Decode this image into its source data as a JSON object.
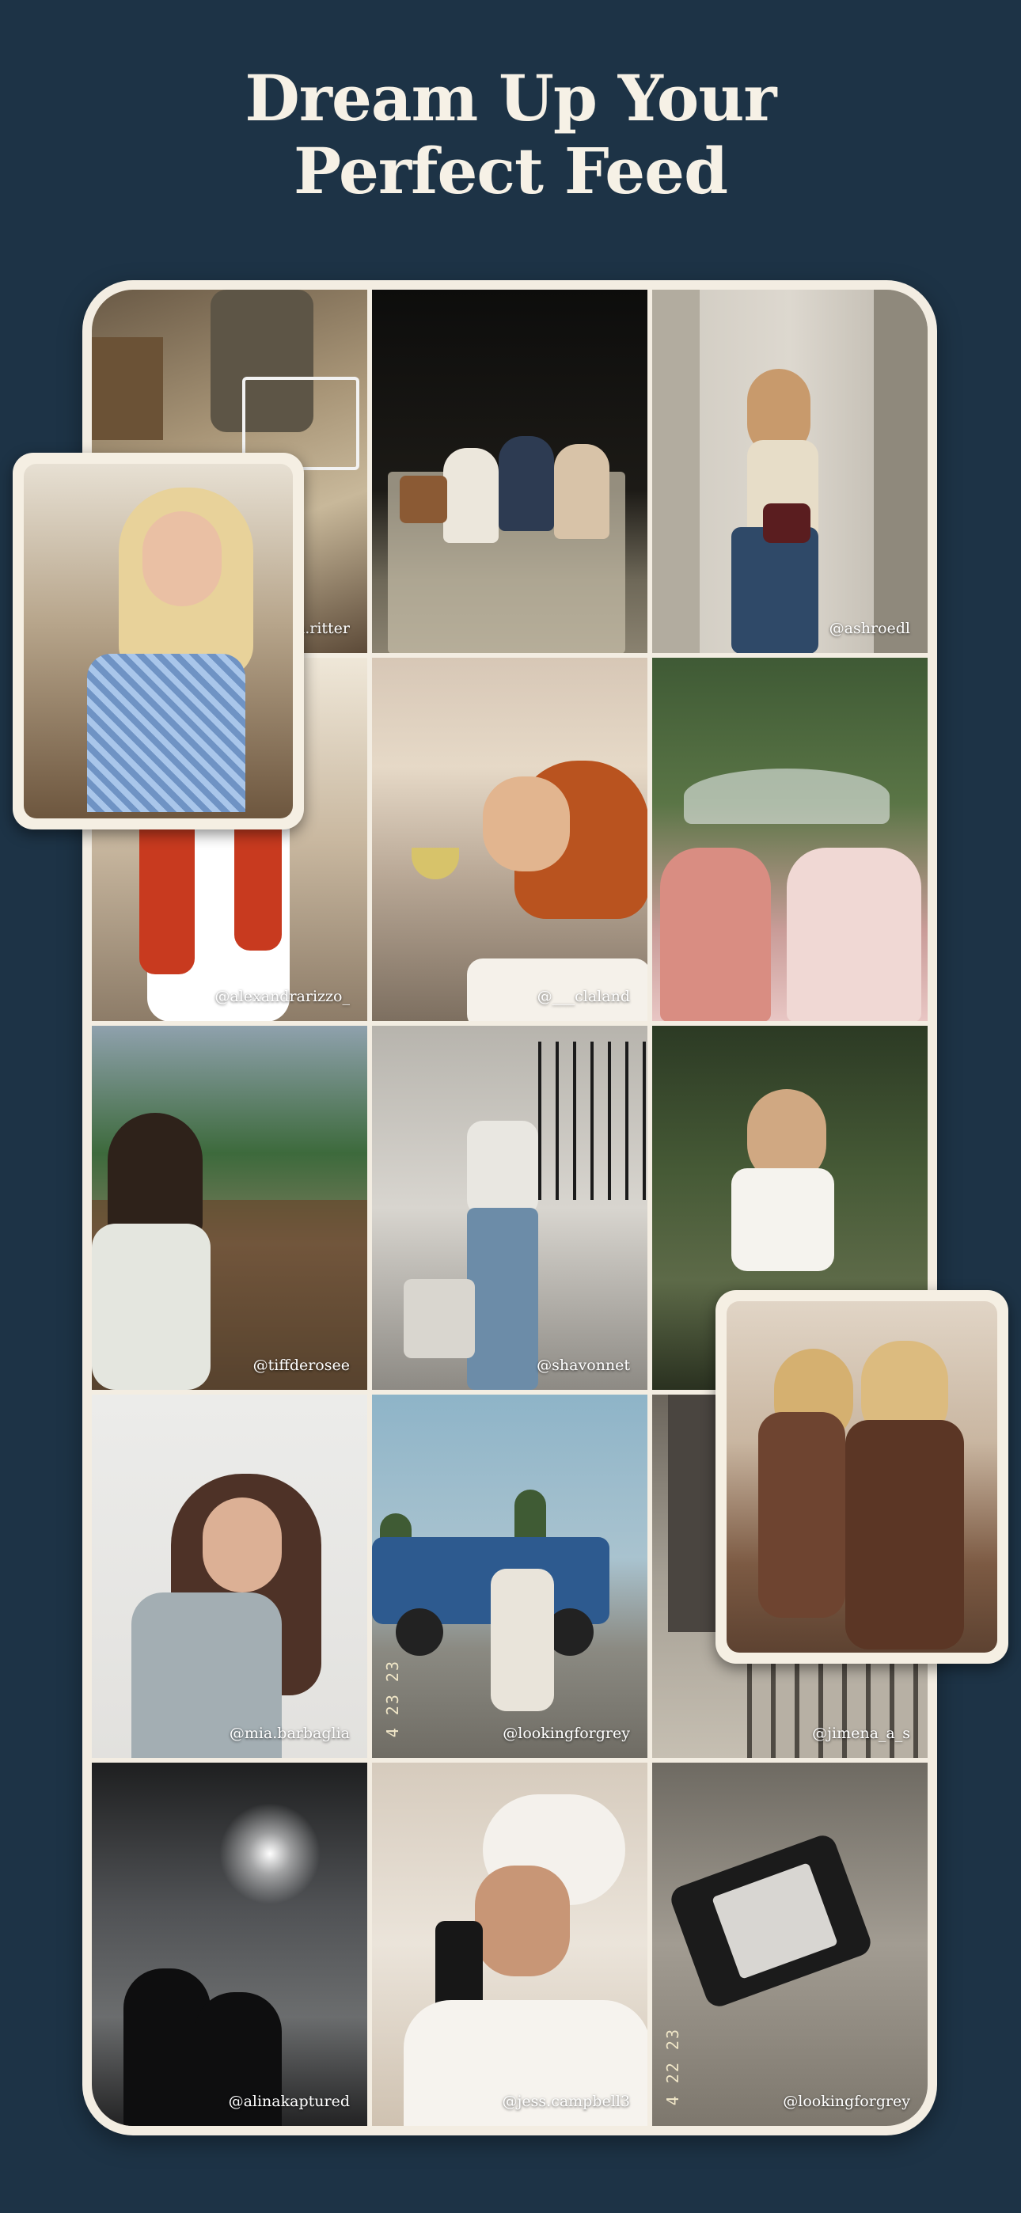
{
  "headline": {
    "line1": "Dream Up Your",
    "line2": "Perfect Feed"
  },
  "grid": {
    "tiles": [
      {
        "handle": "@ a.ritter",
        "desc": "market basket photo"
      },
      {
        "handle": "",
        "desc": "friends picnic at night"
      },
      {
        "handle": "@ashroedl",
        "desc": "woman with red bag by stone wall"
      },
      {
        "handle": "@alexandrarizzo_",
        "desc": "red sweater with wine glass"
      },
      {
        "handle": "@___claland",
        "desc": "martini by harbor at sunset"
      },
      {
        "handle": "",
        "desc": "two women under clear umbrella"
      },
      {
        "handle": "@tiffderosee",
        "desc": "woman on boat by lake"
      },
      {
        "handle": "@shavonnet",
        "desc": "mirror selfie by stairs"
      },
      {
        "handle": "",
        "desc": "woman in white top outdoors"
      },
      {
        "handle": "@mia.barbaglia",
        "desc": "studio portrait"
      },
      {
        "handle": "@lookingforgrey",
        "desc": "woman by blue truck",
        "stamp": "4 23 23"
      },
      {
        "handle": "@jimena_a_s",
        "desc": "building columns"
      },
      {
        "handle": "@alinakaptured",
        "desc": "couple watching fireworks"
      },
      {
        "handle": "@jess.campbell3",
        "desc": "towel mirror selfie"
      },
      {
        "handle": "@lookingforgrey",
        "desc": "phone in sand",
        "stamp": "4 22 23"
      }
    ]
  },
  "floating_cards": [
    {
      "desc": "blonde woman in gingham top"
    },
    {
      "desc": "two women in brown dresses"
    }
  ]
}
